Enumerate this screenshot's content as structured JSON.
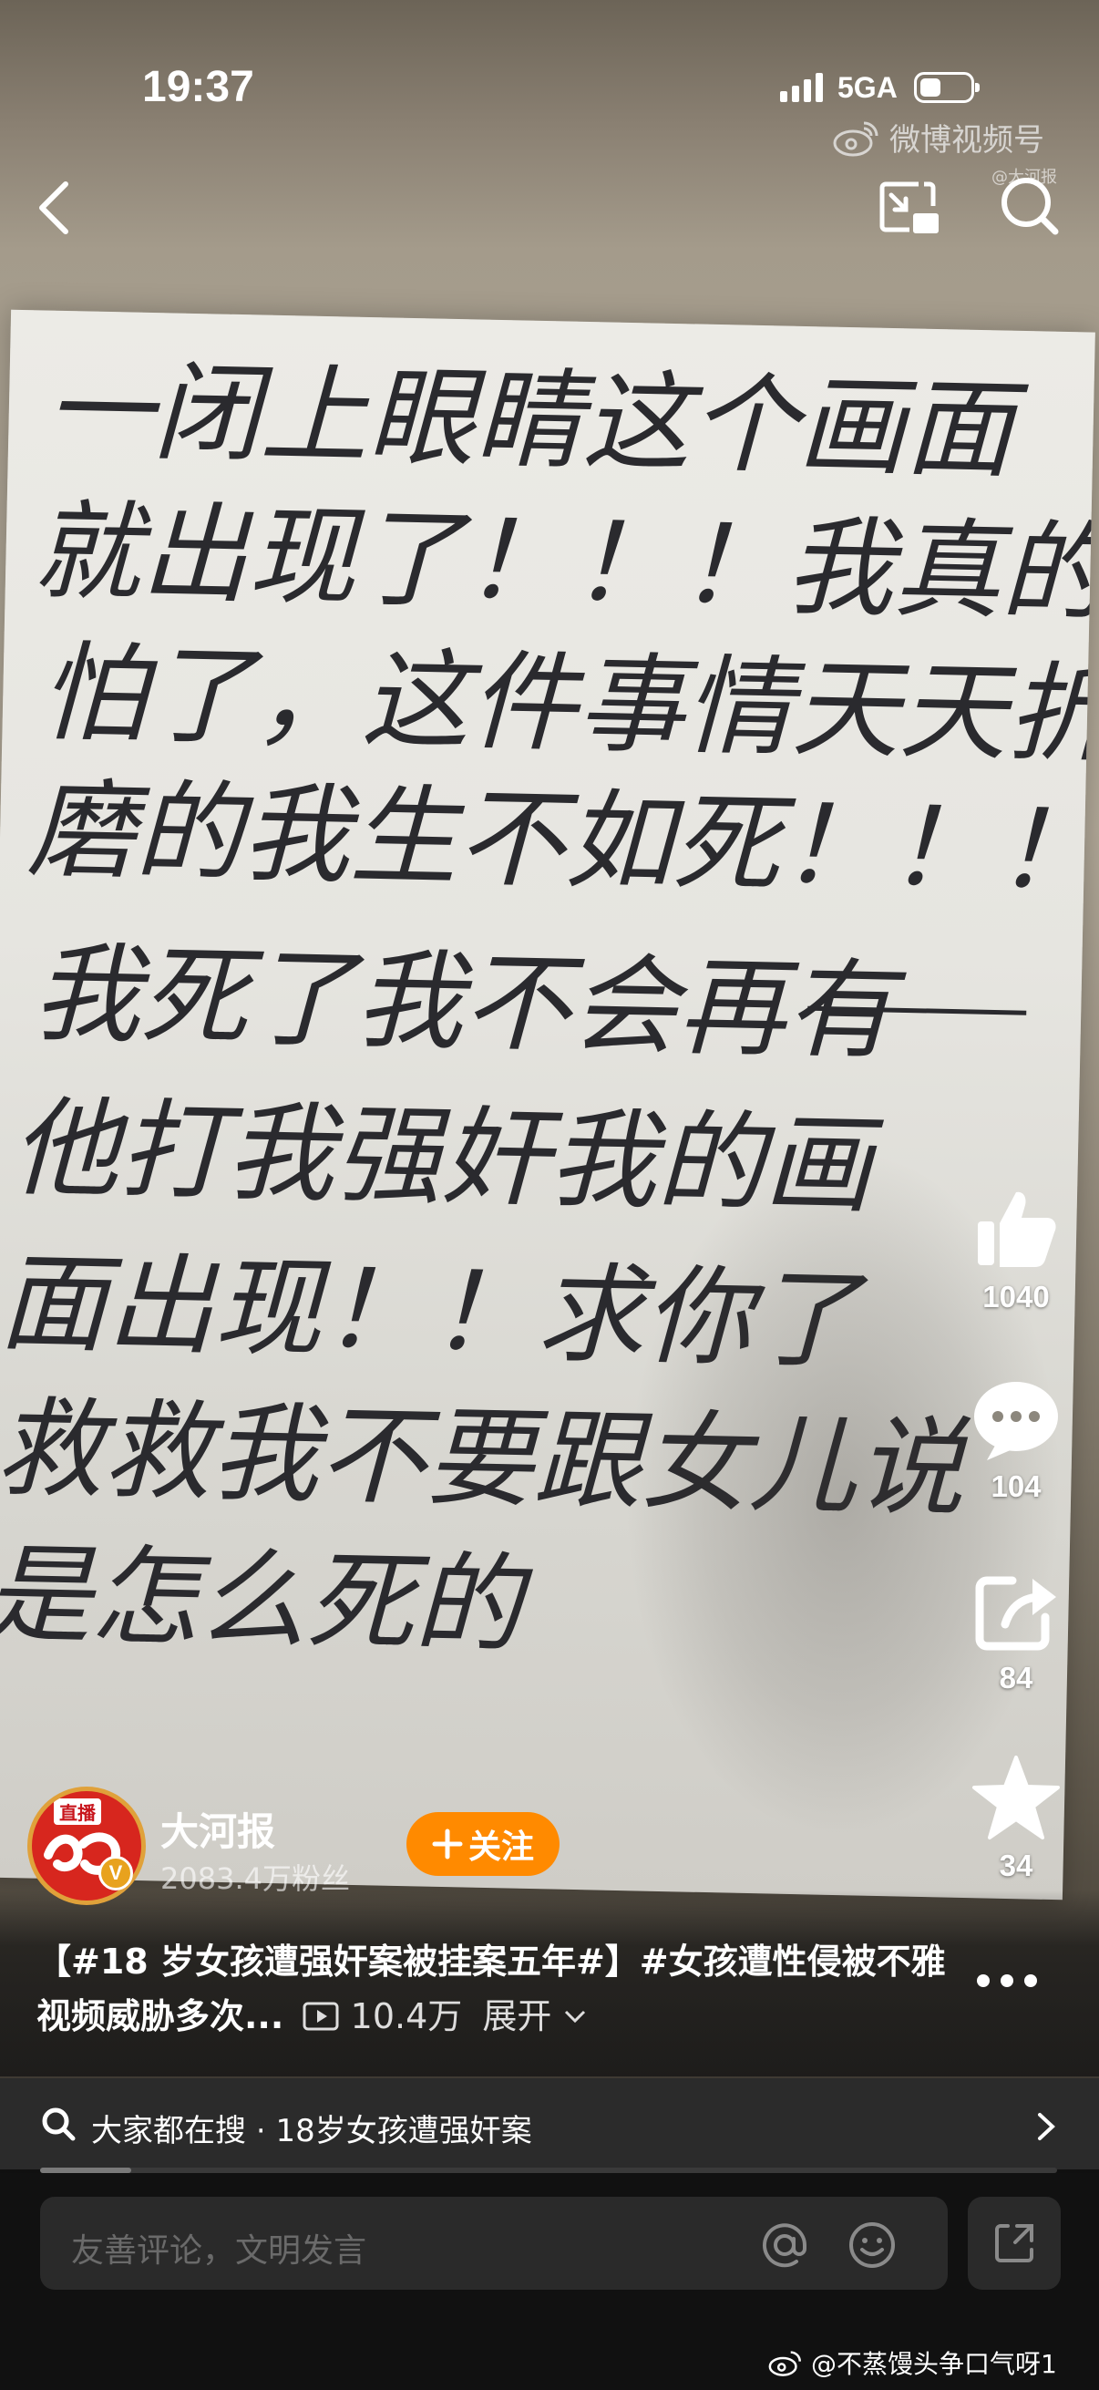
{
  "status_bar": {
    "time": "19:37",
    "network": "5GA"
  },
  "watermark": {
    "brand": "微博视频号",
    "sub": "@大河报"
  },
  "note": {
    "lines": [
      "一闭上眼睛这个画面",
      "就出现了！！！我真的太害",
      "怕了，这件事情天天折",
      "磨的我生不如死！！！",
      "我死了我不会再有",
      "他打我强奸我的画",
      "面出现！！求你了",
      "救救我不要跟女儿说",
      "是怎么死的"
    ]
  },
  "actions": {
    "like_count": "1040",
    "comment_count": "104",
    "share_count": "84",
    "favorite_count": "34"
  },
  "author": {
    "live_tag": "直播",
    "name": "大河报",
    "fans": "2083.4万粉丝",
    "follow_label": "关注"
  },
  "caption": {
    "text": "【#18 岁女孩遭强奸案被挂案五年#】#女孩遭性侵被不雅视频威胁多次...",
    "plays": "10.4万",
    "expand": "展开"
  },
  "search": {
    "prefix": "大家都在搜",
    "query": "18岁女孩遭强奸案"
  },
  "progress": {
    "fraction": 0.09
  },
  "comment": {
    "placeholder": "友善评论，文明发言"
  },
  "credit": "@不蒸馒头争口气呀1"
}
